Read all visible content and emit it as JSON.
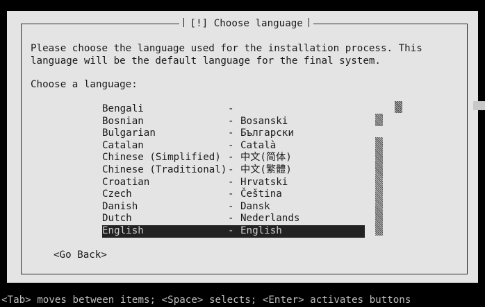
{
  "dialog": {
    "title": "[!] Choose language",
    "prompt_line1": "Please choose the language used for the installation process. This",
    "prompt_line2": "language will be the default language for the final system.",
    "choose_label": "Choose a language:",
    "go_back_label": "<Go Back>"
  },
  "languages": [
    {
      "name": "Bengali",
      "dash": "-",
      "native": ""
    },
    {
      "name": "Bosnian",
      "dash": "-",
      "native": "Bosanski"
    },
    {
      "name": "Bulgarian",
      "dash": "-",
      "native": "Български"
    },
    {
      "name": "Catalan",
      "dash": "-",
      "native": "Català"
    },
    {
      "name": "Chinese (Simplified)",
      "dash": "-",
      "native": "中文(简体)"
    },
    {
      "name": "Chinese (Traditional)",
      "dash": "-",
      "native": "中文(繁體)"
    },
    {
      "name": "Croatian",
      "dash": "-",
      "native": "Hrvatski"
    },
    {
      "name": "Czech",
      "dash": "-",
      "native": "Čeština"
    },
    {
      "name": "Danish",
      "dash": "-",
      "native": "Dansk"
    },
    {
      "name": "Dutch",
      "dash": "-",
      "native": "Nederlands"
    },
    {
      "name": "English",
      "dash": "-",
      "native": "English",
      "selected": true
    }
  ],
  "status_bar": {
    "text": "<Tab> moves between items; <Space> selects; <Enter> activates buttons"
  },
  "colors": {
    "dialog_bg": "#e4e4e4",
    "selected_bg": "#222222",
    "selected_fg": "#cfcfcf",
    "screen_bg": "#000000",
    "status_fg": "#bdbdbd"
  }
}
